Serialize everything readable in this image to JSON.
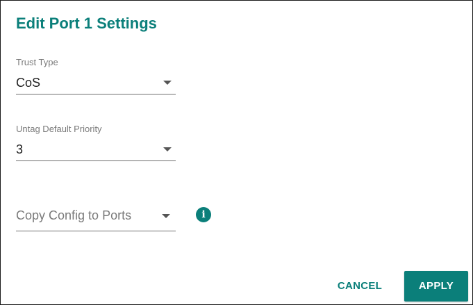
{
  "dialog": {
    "title": "Edit Port 1 Settings"
  },
  "fields": {
    "trust_type": {
      "label": "Trust Type",
      "value": "CoS"
    },
    "untag_default_priority": {
      "label": "Untag Default Priority",
      "value": "3"
    },
    "copy_config": {
      "placeholder": "Copy Config to Ports"
    }
  },
  "icons": {
    "caret": "chevron-down-icon",
    "info": "info-icon",
    "info_glyph": "i"
  },
  "actions": {
    "cancel_label": "CANCEL",
    "apply_label": "APPLY"
  },
  "colors": {
    "accent": "#0b7f7a",
    "text": "#1f1f1f",
    "muted": "#7a7a7a"
  }
}
